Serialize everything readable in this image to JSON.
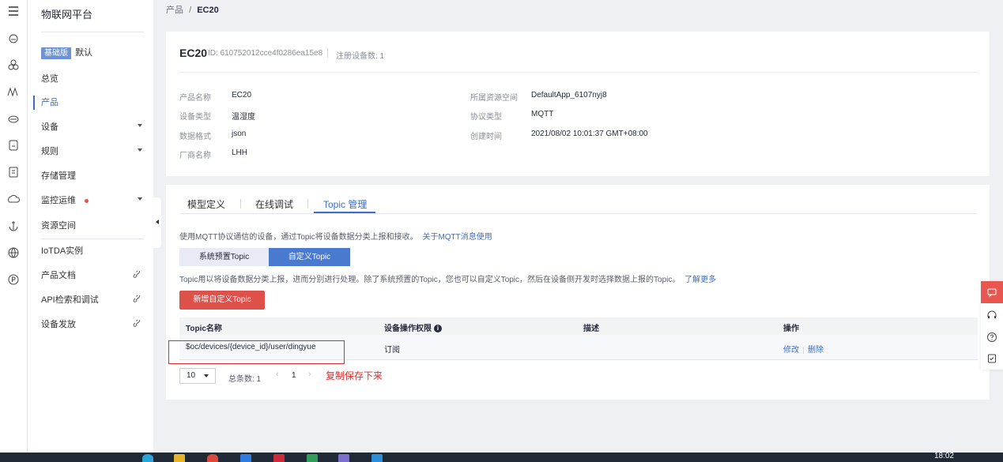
{
  "sidebar": {
    "title": "物联网平台",
    "edition_badge": "基础版",
    "instance_label": "默认",
    "items": [
      {
        "label": "总览"
      },
      {
        "label": "产品"
      },
      {
        "label": "设备"
      },
      {
        "label": "规则"
      },
      {
        "label": "存储管理"
      },
      {
        "label": "监控运维"
      },
      {
        "label": "资源空间"
      },
      {
        "label": "IoTDA实例"
      },
      {
        "label": "产品文档"
      },
      {
        "label": "API检索和调试"
      },
      {
        "label": "设备发放"
      }
    ]
  },
  "breadcrumb": {
    "parent": "产品",
    "separator": "/",
    "current": "EC20"
  },
  "product": {
    "name": "EC20",
    "id_text": "ID: 610752012cce4f0286ea15e8",
    "device_count_text": "注册设备数: 1",
    "fields": {
      "product_name": {
        "label": "产品名称",
        "value": "EC20"
      },
      "device_type": {
        "label": "设备类型",
        "value": "温湿度"
      },
      "data_format": {
        "label": "数据格式",
        "value": "json"
      },
      "vendor": {
        "label": "厂商名称",
        "value": "LHH"
      },
      "resource_space": {
        "label": "所属资源空间",
        "value": "DefaultApp_6107nyj8"
      },
      "protocol": {
        "label": "协议类型",
        "value": "MQTT"
      },
      "created": {
        "label": "创建时间",
        "value": "2021/08/02 10:01:37 GMT+08:00"
      }
    }
  },
  "tabs": [
    {
      "label": "模型定义"
    },
    {
      "label": "在线调试"
    },
    {
      "label": "Topic 管理"
    }
  ],
  "topic": {
    "intro": "使用MQTT协议通信的设备，通过Topic将设备数据分类上报和接收。",
    "intro_link": "关于MQTT消息使用",
    "seg_preset": "系统预置Topic",
    "seg_custom": "自定义Topic",
    "custom_desc": "Topic用以将设备数据分类上报，进而分别进行处理。除了系统预置的Topic，您也可以自定义Topic，然后在设备侧开发时选择数据上报的Topic。",
    "custom_link": "了解更多",
    "add_button": "新增自定义Topic",
    "columns": {
      "name": "Topic名称",
      "permission": "设备操作权限",
      "description": "描述",
      "actions": "操作"
    },
    "rows": [
      {
        "name": "$oc/devices/{device_id}/user/dingyue",
        "permission": "订阅",
        "description": "",
        "edit": "修改",
        "delete": "删除"
      }
    ],
    "pager": {
      "page_size": "10",
      "total": "总条数: 1",
      "prev": "‹",
      "page": "1",
      "next": "›"
    },
    "annotation": "复制保存下来"
  },
  "taskbar": {
    "clock": "18:02"
  },
  "colors": {
    "primary": "#3c6ec8",
    "danger": "#de504a",
    "annotation": "#e02b2b"
  }
}
